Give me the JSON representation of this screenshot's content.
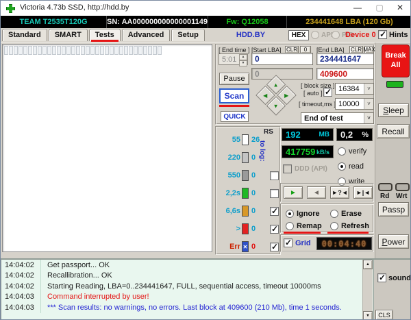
{
  "window": {
    "title": "Victoria 4.73b SSD, http://hdd.by"
  },
  "icons": {
    "minimize": "—",
    "maximize": "▢",
    "close": "✕",
    "dropdown": "˅",
    "spin_up": "▲",
    "spin_down": "▼",
    "scroll_up": "▲",
    "scroll_down": "▼",
    "pad_up": "▲",
    "pad_right": "▶",
    "pad_left": "◀",
    "pad_down": "▼",
    "play": "►",
    "back": "◄",
    "seek_scan": "►?◄",
    "seek_end": "►|◄",
    "err_x": "✕"
  },
  "info_bar": {
    "model": "TEAM T2535T120G",
    "serial": "SN: AA000000000000001149",
    "firmware": "Fw: Q12058",
    "capacity": "234441648 LBA (120 Gb)"
  },
  "nav": {
    "tabs": [
      "Standard",
      "SMART",
      "Tests",
      "Advanced",
      "Setup"
    ],
    "active_tab": "Tests",
    "brand": "HDD.BY",
    "hex": "HEX",
    "api": "API",
    "pio": "PIO",
    "device": "Device 0",
    "hints": "Hints"
  },
  "controls": {
    "end_time_label": "[ End time ]",
    "end_time_value": "5:01",
    "start_lba_label": "[Start LBA]",
    "clr_label": "CLR",
    "zero_label": "0",
    "end_lba_label": "[End LBA]",
    "max_label": "MAX",
    "start_lba_value": "0",
    "end_lba_value": "234441647",
    "current_lba_value": "0",
    "last_block_value": "409600",
    "pause": "Pause",
    "scan": "Scan",
    "quick": "QUICK",
    "block_size_label": "[ block size ]",
    "auto_label": "[ auto ]",
    "block_size_value": "16384",
    "timeout_label": "[ timeout,ms ]",
    "timeout_value": "10000",
    "end_of_test": "End of test"
  },
  "legend": {
    "rs_label": "RS",
    "to_log_label": "to log:",
    "rows": [
      {
        "label": "55",
        "count": "26",
        "color": "#ffffff",
        "checkbox": "none",
        "checked": false,
        "err": false
      },
      {
        "label": "220",
        "count": "0",
        "color": "#c4c4c4",
        "checkbox": "none",
        "checked": false,
        "err": false
      },
      {
        "label": "550",
        "count": "0",
        "color": "#9a9a9a",
        "checkbox": "show",
        "checked": false,
        "err": false
      },
      {
        "label": "2,2s",
        "count": "0",
        "color": "#1fb825",
        "checkbox": "show",
        "checked": false,
        "err": false
      },
      {
        "label": "6,6s",
        "count": "0",
        "color": "#d89828",
        "checkbox": "show",
        "checked": true,
        "err": false
      },
      {
        "label": ">",
        "count": "0",
        "color": "#e32222",
        "checkbox": "show",
        "checked": true,
        "err": false
      },
      {
        "label": "Err",
        "count": "0",
        "color": "#2f51c8",
        "checkbox": "show",
        "checked": true,
        "err": true
      }
    ]
  },
  "monitor": {
    "mb_value": "192",
    "mb_unit": "MB",
    "percent_value": "0,2",
    "percent_unit": "%",
    "speed_value": "417759",
    "speed_unit": "kB/s",
    "ddd_label": "DDD (API)",
    "mode_verify": "verify",
    "mode_read": "read",
    "mode_write": "write",
    "action_ignore": "Ignore",
    "action_erase": "Erase",
    "action_remap": "Remap",
    "action_refresh": "Refresh",
    "grid_label": "Grid",
    "timer": "00:04:40"
  },
  "side": {
    "break_all": "Break All",
    "sleep": "Sleep",
    "recall": "Recall",
    "rd": "Rd",
    "wrt": "Wrt",
    "passp": "Passp",
    "power": "Power"
  },
  "log": {
    "entries": [
      {
        "time": "14:04:02",
        "message": "Get passport... OK",
        "color": "#1a1a1a"
      },
      {
        "time": "14:04:02",
        "message": "Recallibration... OK",
        "color": "#1a1a1a"
      },
      {
        "time": "14:04:02",
        "message": "Starting Reading, LBA=0..234441647, FULL, sequential access, timeout 10000ms",
        "color": "#1a1a1a"
      },
      {
        "time": "14:04:03",
        "message": "Command interrupted by user!",
        "color": "#e51414"
      },
      {
        "time": "14:04:03",
        "message": "*** Scan results: no warnings, no errors. Last block at 409600 (210 Mb), time 1 seconds.",
        "color": "#1f1fd2"
      }
    ],
    "sound_label": "sound",
    "cls_label": "CLS"
  },
  "map": {
    "block_count": 33
  }
}
